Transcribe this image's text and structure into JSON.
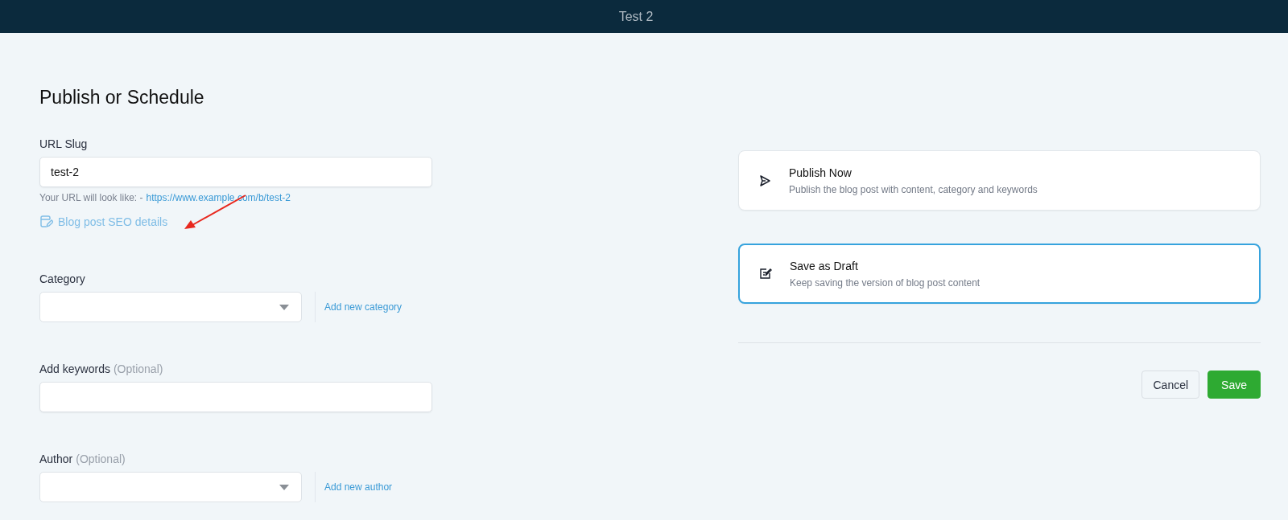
{
  "window": {
    "title": "Test 2"
  },
  "heading": "Publish or Schedule",
  "url_slug": {
    "label": "URL Slug",
    "value": "test-2",
    "hint": "Your URL will look like: -",
    "url": "https://www.example.com/b/test-2"
  },
  "seo_link": "Blog post SEO details",
  "category": {
    "label": "Category",
    "add_link": "Add new category"
  },
  "keywords": {
    "label": "Add keywords",
    "optional": "(Optional)"
  },
  "author": {
    "label": "Author",
    "optional": "(Optional)",
    "add_link": "Add new author"
  },
  "options": [
    {
      "kind": "publish",
      "title": "Publish Now",
      "description": "Publish the blog post with content, category and keywords",
      "selected": false
    },
    {
      "kind": "draft",
      "title": "Save as Draft",
      "description": "Keep saving the version of blog post content",
      "selected": true
    }
  ],
  "buttons": {
    "cancel": "Cancel",
    "save": "Save"
  }
}
